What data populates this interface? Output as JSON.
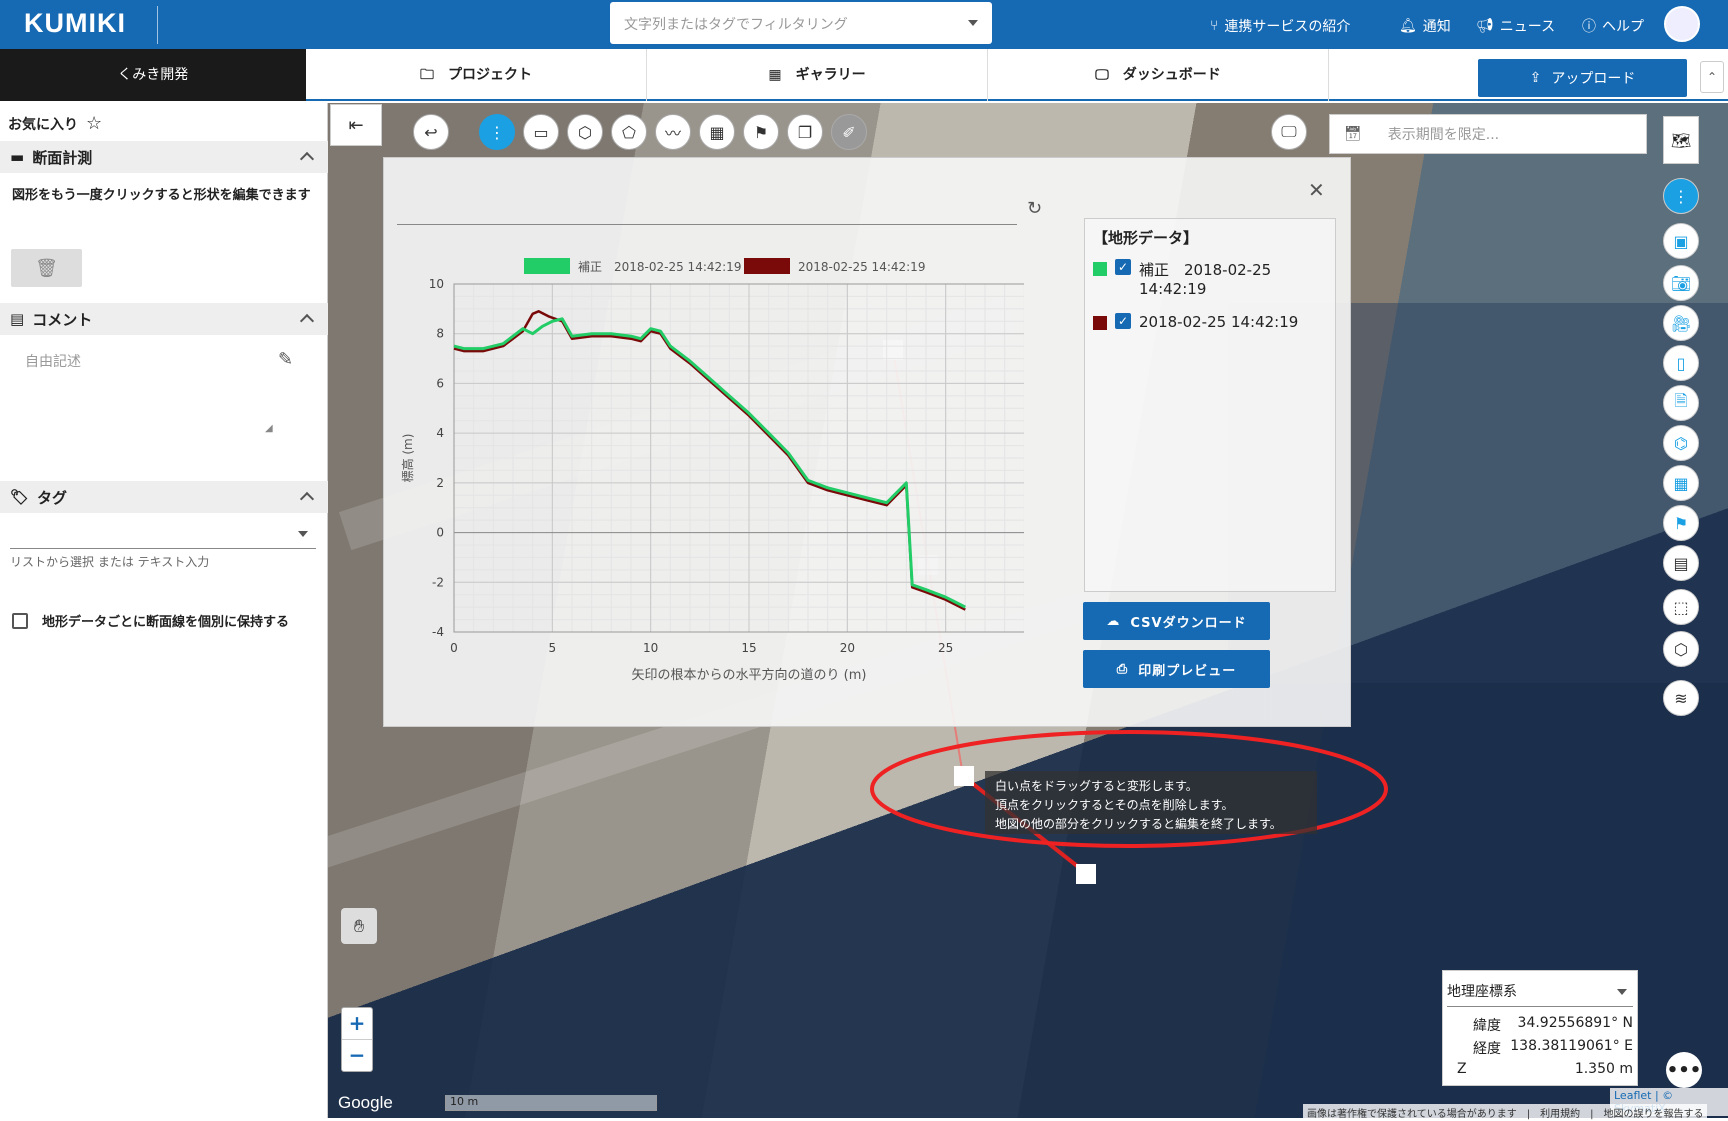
{
  "header": {
    "logo": "KUMIKI",
    "search_placeholder": "文字列またはタグでフィルタリング",
    "nav": [
      "連携サービスの紹介",
      "通知",
      "ニュース",
      "ヘルプ"
    ]
  },
  "subnav": {
    "workspace": "くみき開発",
    "tabs": [
      "プロジェクト",
      "ギャラリー",
      "ダッシュボード"
    ],
    "upload": "アップロード"
  },
  "sidebar": {
    "favorite": "お気に入り",
    "sec1": "断面計測",
    "hint": "図形をもう一度クリックすると形状を編集できます",
    "sec2": "コメント",
    "comment_placeholder": "自由記述",
    "sec3": "タグ",
    "tag_hint": "リストから選択 または テキスト入力",
    "checkbox": "地形データごとに断面線を個別に保持する"
  },
  "map": {
    "period_placeholder": "表示期間を限定...",
    "tooltip": [
      "白い点をドラッグすると変形します。",
      "頂点をクリックするとその点を削除します。",
      "地図の他の部分をクリックすると編集を終了します。"
    ],
    "scale": "10 m",
    "google": "Google",
    "attribution": "Leaflet | © SkymatiX",
    "footer": "画像は著作権で保護されている場合があります　|　利用規約　|　地図の誤りを報告する"
  },
  "coords": {
    "system": "地理座標系",
    "lat_label": "緯度",
    "lat": "34.92556891° N",
    "lng_label": "経度",
    "lng": "138.38119061° E",
    "z_label": "Z",
    "z": "1.350 m"
  },
  "legend": {
    "title": "【地形データ】",
    "items": [
      {
        "label": "補正　2018-02-25 14:42:19",
        "color": "#22cc66"
      },
      {
        "label": "2018-02-25 14:42:19",
        "color": "#7a0a0a"
      }
    ]
  },
  "buttons": {
    "csv": "CSVダウンロード",
    "print": "印刷プレビュー"
  },
  "chart_data": {
    "type": "line",
    "xlabel": "矢印の根本からの水平方向の道のり (m)",
    "ylabel": "標高 (m)",
    "xlim": [
      0,
      30
    ],
    "ylim": [
      -4,
      10
    ],
    "xticks": [
      0,
      5,
      10,
      15,
      20,
      25,
      30
    ],
    "yticks": [
      -4,
      -2,
      0,
      2,
      4,
      6,
      8,
      10
    ],
    "series": [
      {
        "name": "補正　2018-02-25 14:42:19",
        "color": "#22cc66",
        "x": [
          0,
          0.5,
          1.5,
          2.5,
          3,
          3.5,
          4,
          4.5,
          5,
          5.5,
          6,
          7,
          8,
          9,
          9.5,
          10,
          10.5,
          11,
          12,
          13,
          14,
          15,
          16,
          17,
          18,
          19,
          20,
          21,
          22,
          22.5,
          23,
          23.3,
          24,
          25,
          26
        ],
        "y": [
          7.5,
          7.4,
          7.4,
          7.6,
          7.9,
          8.2,
          8.0,
          8.3,
          8.5,
          8.6,
          7.9,
          8.0,
          8.0,
          7.9,
          7.8,
          8.2,
          8.1,
          7.5,
          6.9,
          6.2,
          5.5,
          4.8,
          4.0,
          3.2,
          2.1,
          1.8,
          1.6,
          1.4,
          1.2,
          1.6,
          2.0,
          -2.1,
          -2.3,
          -2.6,
          -3.0
        ]
      },
      {
        "name": "2018-02-25 14:42:19",
        "color": "#7a0a0a",
        "x": [
          0,
          0.5,
          1.5,
          2.5,
          3,
          3.5,
          4,
          4.3,
          4.8,
          5.5,
          6,
          7,
          8,
          9,
          9.5,
          10,
          10.5,
          11,
          12,
          13,
          14,
          15,
          16,
          17,
          18,
          19,
          20,
          21,
          22,
          22.5,
          23,
          23.3,
          24,
          25,
          26
        ],
        "y": [
          7.4,
          7.3,
          7.3,
          7.5,
          7.8,
          8.1,
          8.8,
          8.9,
          8.7,
          8.5,
          7.8,
          7.9,
          7.9,
          7.8,
          7.7,
          8.1,
          8.0,
          7.4,
          6.8,
          6.1,
          5.4,
          4.7,
          3.9,
          3.1,
          2.0,
          1.7,
          1.5,
          1.3,
          1.1,
          1.5,
          1.9,
          -2.2,
          -2.4,
          -2.7,
          -3.1
        ]
      }
    ]
  }
}
